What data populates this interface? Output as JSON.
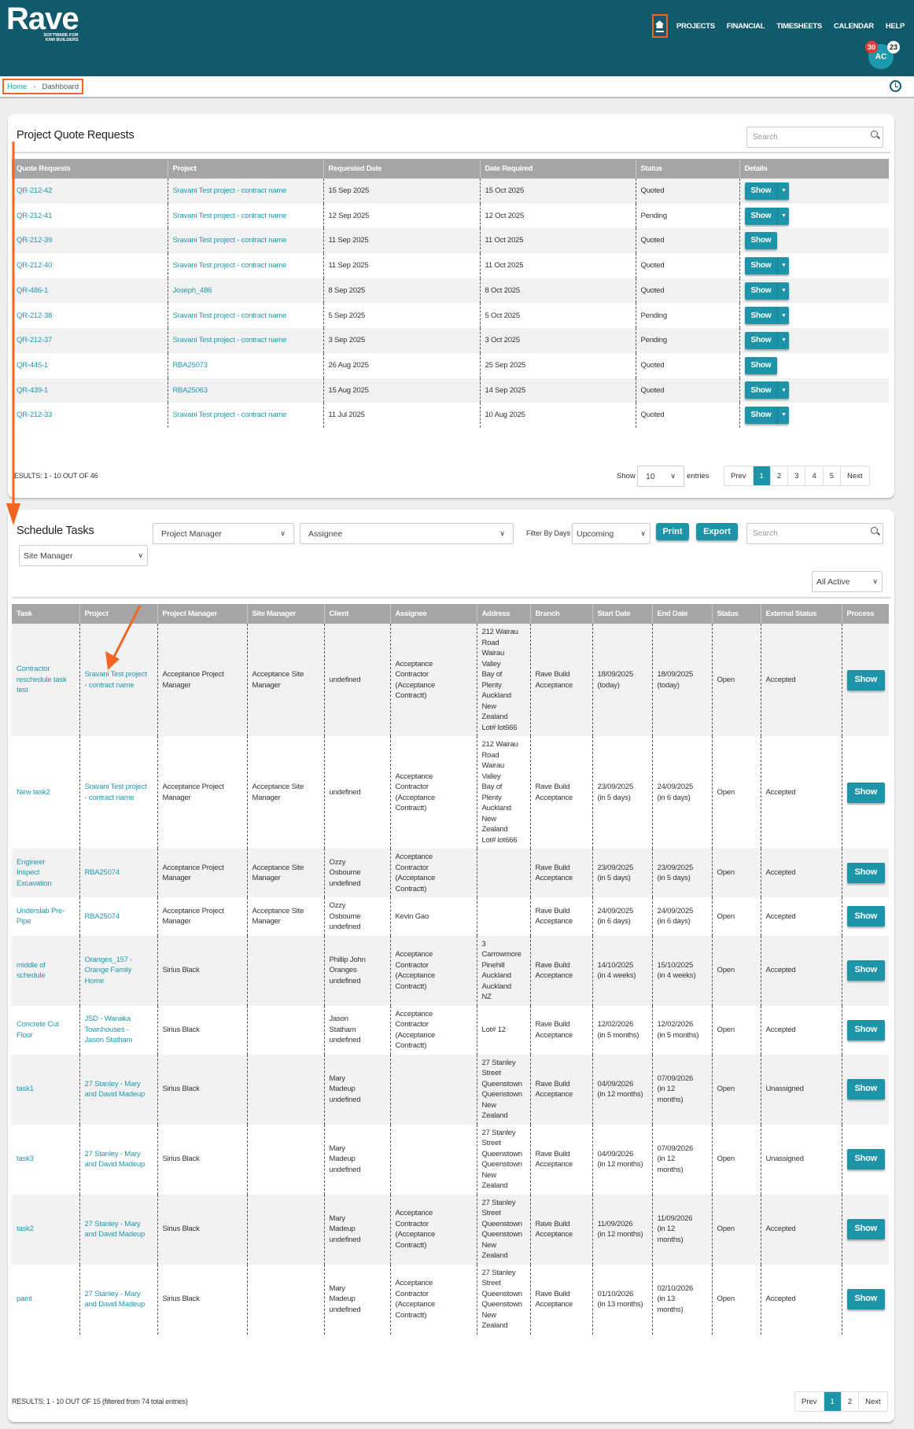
{
  "header": {
    "logo": "Rave",
    "logo_tagline": "SOFTWARE FOR\nKIWI BUILDERS",
    "nav": [
      "PROJECTS",
      "FINANCIAL",
      "TIMESHEETS",
      "CALENDAR",
      "HELP"
    ],
    "avatar": "AC",
    "badge_red": "30",
    "badge_white": "23"
  },
  "breadcrumb": {
    "home": "Home",
    "sep": "›",
    "current": "Dashboard"
  },
  "quotes": {
    "title": "Project Quote Requests",
    "search_placeholder": "Search",
    "columns": [
      "Quote Requests",
      "Project",
      "Requested Date",
      "Date Required",
      "Status",
      "Details"
    ],
    "rows": [
      {
        "id": "QR-212-42",
        "project": "Sravani Test project - contract name",
        "requested": "15 Sep 2025",
        "required": "15 Oct 2025",
        "status": "Quoted",
        "dropdown": true
      },
      {
        "id": "QR-212-41",
        "project": "Sravani Test project - contract name",
        "requested": "12 Sep 2025",
        "required": "12 Oct 2025",
        "status": "Pending",
        "dropdown": true
      },
      {
        "id": "QR-212-39",
        "project": "Sravani Test project - contract name",
        "requested": "11 Sep 2025",
        "required": "11 Oct 2025",
        "status": "Quoted",
        "dropdown": false
      },
      {
        "id": "QR-212-40",
        "project": "Sravani Test project - contract name",
        "requested": "11 Sep 2025",
        "required": "11 Oct 2025",
        "status": "Quoted",
        "dropdown": true
      },
      {
        "id": "QR-486-1",
        "project": "Joseph_486",
        "requested": "8 Sep 2025",
        "required": "8 Oct 2025",
        "status": "Quoted",
        "dropdown": true
      },
      {
        "id": "QR-212-38",
        "project": "Sravani Test project - contract name",
        "requested": "5 Sep 2025",
        "required": "5 Oct 2025",
        "status": "Pending",
        "dropdown": true
      },
      {
        "id": "QR-212-37",
        "project": "Sravani Test project - contract name",
        "requested": "3 Sep 2025",
        "required": "3 Oct 2025",
        "status": "Pending",
        "dropdown": true
      },
      {
        "id": "QR-445-1",
        "project": "RBA25073",
        "requested": "26 Aug 2025",
        "required": "25 Sep 2025",
        "status": "Quoted",
        "dropdown": false
      },
      {
        "id": "QR-439-1",
        "project": "RBA25063",
        "requested": "15 Aug 2025",
        "required": "14 Sep 2025",
        "status": "Quoted",
        "dropdown": true
      },
      {
        "id": "QR-212-33",
        "project": "Sravani Test project - contract name",
        "requested": "11 Jul 2025",
        "required": "10 Aug 2025",
        "status": "Quoted",
        "dropdown": true
      }
    ],
    "show_label": "Show",
    "results": "ESULTS: 1 - 10 OUT OF 46",
    "show_entries_label": "Show",
    "entries_value": "10",
    "entries_label": "entries",
    "pager": [
      "Prev",
      "1",
      "2",
      "3",
      "4",
      "5",
      "Next"
    ],
    "active_page": "1"
  },
  "tasks": {
    "title": "Schedule Tasks",
    "filters": {
      "project_manager": "Project Manager",
      "assignee": "Assignee",
      "filter_by_days_label": "Filter By Days",
      "days": "Upcoming",
      "site_manager": "Site Manager",
      "active": "All Active"
    },
    "print": "Print",
    "export": "Export",
    "search_placeholder": "Search",
    "columns": [
      "Task",
      "Project",
      "Project Manager",
      "Site Manager",
      "Client",
      "Assignee",
      "Address",
      "Branch",
      "Start Date",
      "End Date",
      "Status",
      "External Status",
      "Process"
    ],
    "rows": [
      {
        "task": "Contractor\nreschedule task\ntest",
        "project": "Sravani Test project\n- contract name",
        "pm": "Acceptance Project\nManager",
        "sm": "Acceptance Site\nManager",
        "client": "undefined",
        "assignee": "Acceptance\nContractor\n(Acceptance\nContractt)",
        "address": "212 Wairau\nRoad\nWairau\nValley\nBay of\nPlenty\nAuckland\nNew\nZealand\nLot# lot666",
        "branch": "Rave Build\nAcceptance",
        "start": "18/09/2025\n(today)",
        "end": "18/09/2025\n(today)",
        "status": "Open",
        "ext": "Accepted"
      },
      {
        "task": "New task2",
        "project": "Sravani Test project\n- contract name",
        "pm": "Acceptance Project\nManager",
        "sm": "Acceptance Site\nManager",
        "client": "undefined",
        "assignee": "Acceptance\nContractor\n(Acceptance\nContractt)",
        "address": "212 Wairau\nRoad\nWairau\nValley\nBay of\nPlenty\nAuckland\nNew\nZealand\nLot# lot666",
        "branch": "Rave Build\nAcceptance",
        "start": "23/09/2025\n(in 5 days)",
        "end": "24/09/2025\n(in 6 days)",
        "status": "Open",
        "ext": "Accepted"
      },
      {
        "task": "Engineer\nInspect\nExcavation",
        "project": "RBA25074",
        "pm": "Acceptance Project\nManager",
        "sm": "Acceptance Site\nManager",
        "client": "Ozzy\nOsbourne\nundefined",
        "assignee": "Acceptance\nContractor\n(Acceptance\nContractt)",
        "address": "",
        "branch": "Rave Build\nAcceptance",
        "start": "23/09/2025\n(in 5 days)",
        "end": "23/09/2025\n(in 5 days)",
        "status": "Open",
        "ext": "Accepted"
      },
      {
        "task": "Underslab Pre-\nPipe",
        "project": "RBA25074",
        "pm": "Acceptance Project\nManager",
        "sm": "Acceptance Site\nManager",
        "client": "Ozzy\nOsbourne\nundefined",
        "assignee": "Kevin Gao",
        "address": "",
        "branch": "Rave Build\nAcceptance",
        "start": "24/09/2025\n(in 6 days)",
        "end": "24/09/2025\n(in 6 days)",
        "status": "Open",
        "ext": "Accepted"
      },
      {
        "task": "middle of\nschedule",
        "project": "Oranges_157 -\nOrange Family\nHome",
        "pm": "Sirius Black",
        "sm": "",
        "client": "Phillip John\nOranges\nundefined",
        "assignee": "Acceptance\nContractor\n(Acceptance\nContractt)",
        "address": "3\nCarrowmore\nPinehill\nAuckland\nAuckland\nNZ",
        "branch": "Rave Build\nAcceptance",
        "start": "14/10/2025\n(in 4 weeks)",
        "end": "15/10/2025\n(in 4 weeks)",
        "status": "Open",
        "ext": "Accepted"
      },
      {
        "task": "Concrete Cut\nFloor",
        "project": "JSD - Wanaka\nTownhouses -\nJason Statham",
        "pm": "Sirius Black",
        "sm": "",
        "client": "Jason\nStatham\nundefined",
        "assignee": "Acceptance\nContractor\n(Acceptance\nContractt)",
        "address": "Lot# 12",
        "branch": "Rave Build\nAcceptance",
        "start": "12/02/2026\n(in 5 months)",
        "end": "12/02/2026\n(in 5 months)",
        "status": "Open",
        "ext": "Accepted"
      },
      {
        "task": "task1",
        "project": "27 Stanley - Mary\nand David Madeup",
        "pm": "Sirius Black",
        "sm": "",
        "client": "Mary\nMadeup\nundefined",
        "assignee": "",
        "address": "27 Stanley\nStreet\nQueenstown\nQueenstown\nNew\nZealand",
        "branch": "Rave Build\nAcceptance",
        "start": "04/09/2026\n(in 12 months)",
        "end": "07/09/2026\n(in 12\nmonths)",
        "status": "Open",
        "ext": "Unassigned"
      },
      {
        "task": "task3",
        "project": "27 Stanley - Mary\nand David Madeup",
        "pm": "Sirius Black",
        "sm": "",
        "client": "Mary\nMadeup\nundefined",
        "assignee": "",
        "address": "27 Stanley\nStreet\nQueenstown\nQueenstown\nNew\nZealand",
        "branch": "Rave Build\nAcceptance",
        "start": "04/09/2026\n(in 12 months)",
        "end": "07/09/2026\n(in 12\nmonths)",
        "status": "Open",
        "ext": "Unassigned"
      },
      {
        "task": "task2",
        "project": "27 Stanley - Mary\nand David Madeup",
        "pm": "Sirius Black",
        "sm": "",
        "client": "Mary\nMadeup\nundefined",
        "assignee": "Acceptance\nContractor\n(Acceptance\nContractt)",
        "address": "27 Stanley\nStreet\nQueenstown\nQueenstown\nNew\nZealand",
        "branch": "Rave Build\nAcceptance",
        "start": "11/09/2026\n(in 12 months)",
        "end": "11/09/2026\n(in 12\nmonths)",
        "status": "Open",
        "ext": "Accepted"
      },
      {
        "task": "paint",
        "project": "27 Stanley - Mary\nand David Madeup",
        "pm": "Sirius Black",
        "sm": "",
        "client": "Mary\nMadeup\nundefined",
        "assignee": "Acceptance\nContractor\n(Acceptance\nContractt)",
        "address": "27 Stanley\nStreet\nQueenstown\nQueenstown\nNew\nZealand",
        "branch": "Rave Build\nAcceptance",
        "start": "01/10/2026\n(in 13 months)",
        "end": "02/10/2026\n(in 13\nmonths)",
        "status": "Open",
        "ext": "Accepted"
      }
    ],
    "show_label": "Show",
    "results": "RESULTS: 1 - 10 OUT OF 15 (filtered from 74 total entries)",
    "pager": [
      "Prev",
      "1",
      "2",
      "Next"
    ],
    "active_page": "1"
  },
  "colors": {
    "header": "#115a6c",
    "accent": "#1d94a8",
    "annotation": "#f26522"
  }
}
